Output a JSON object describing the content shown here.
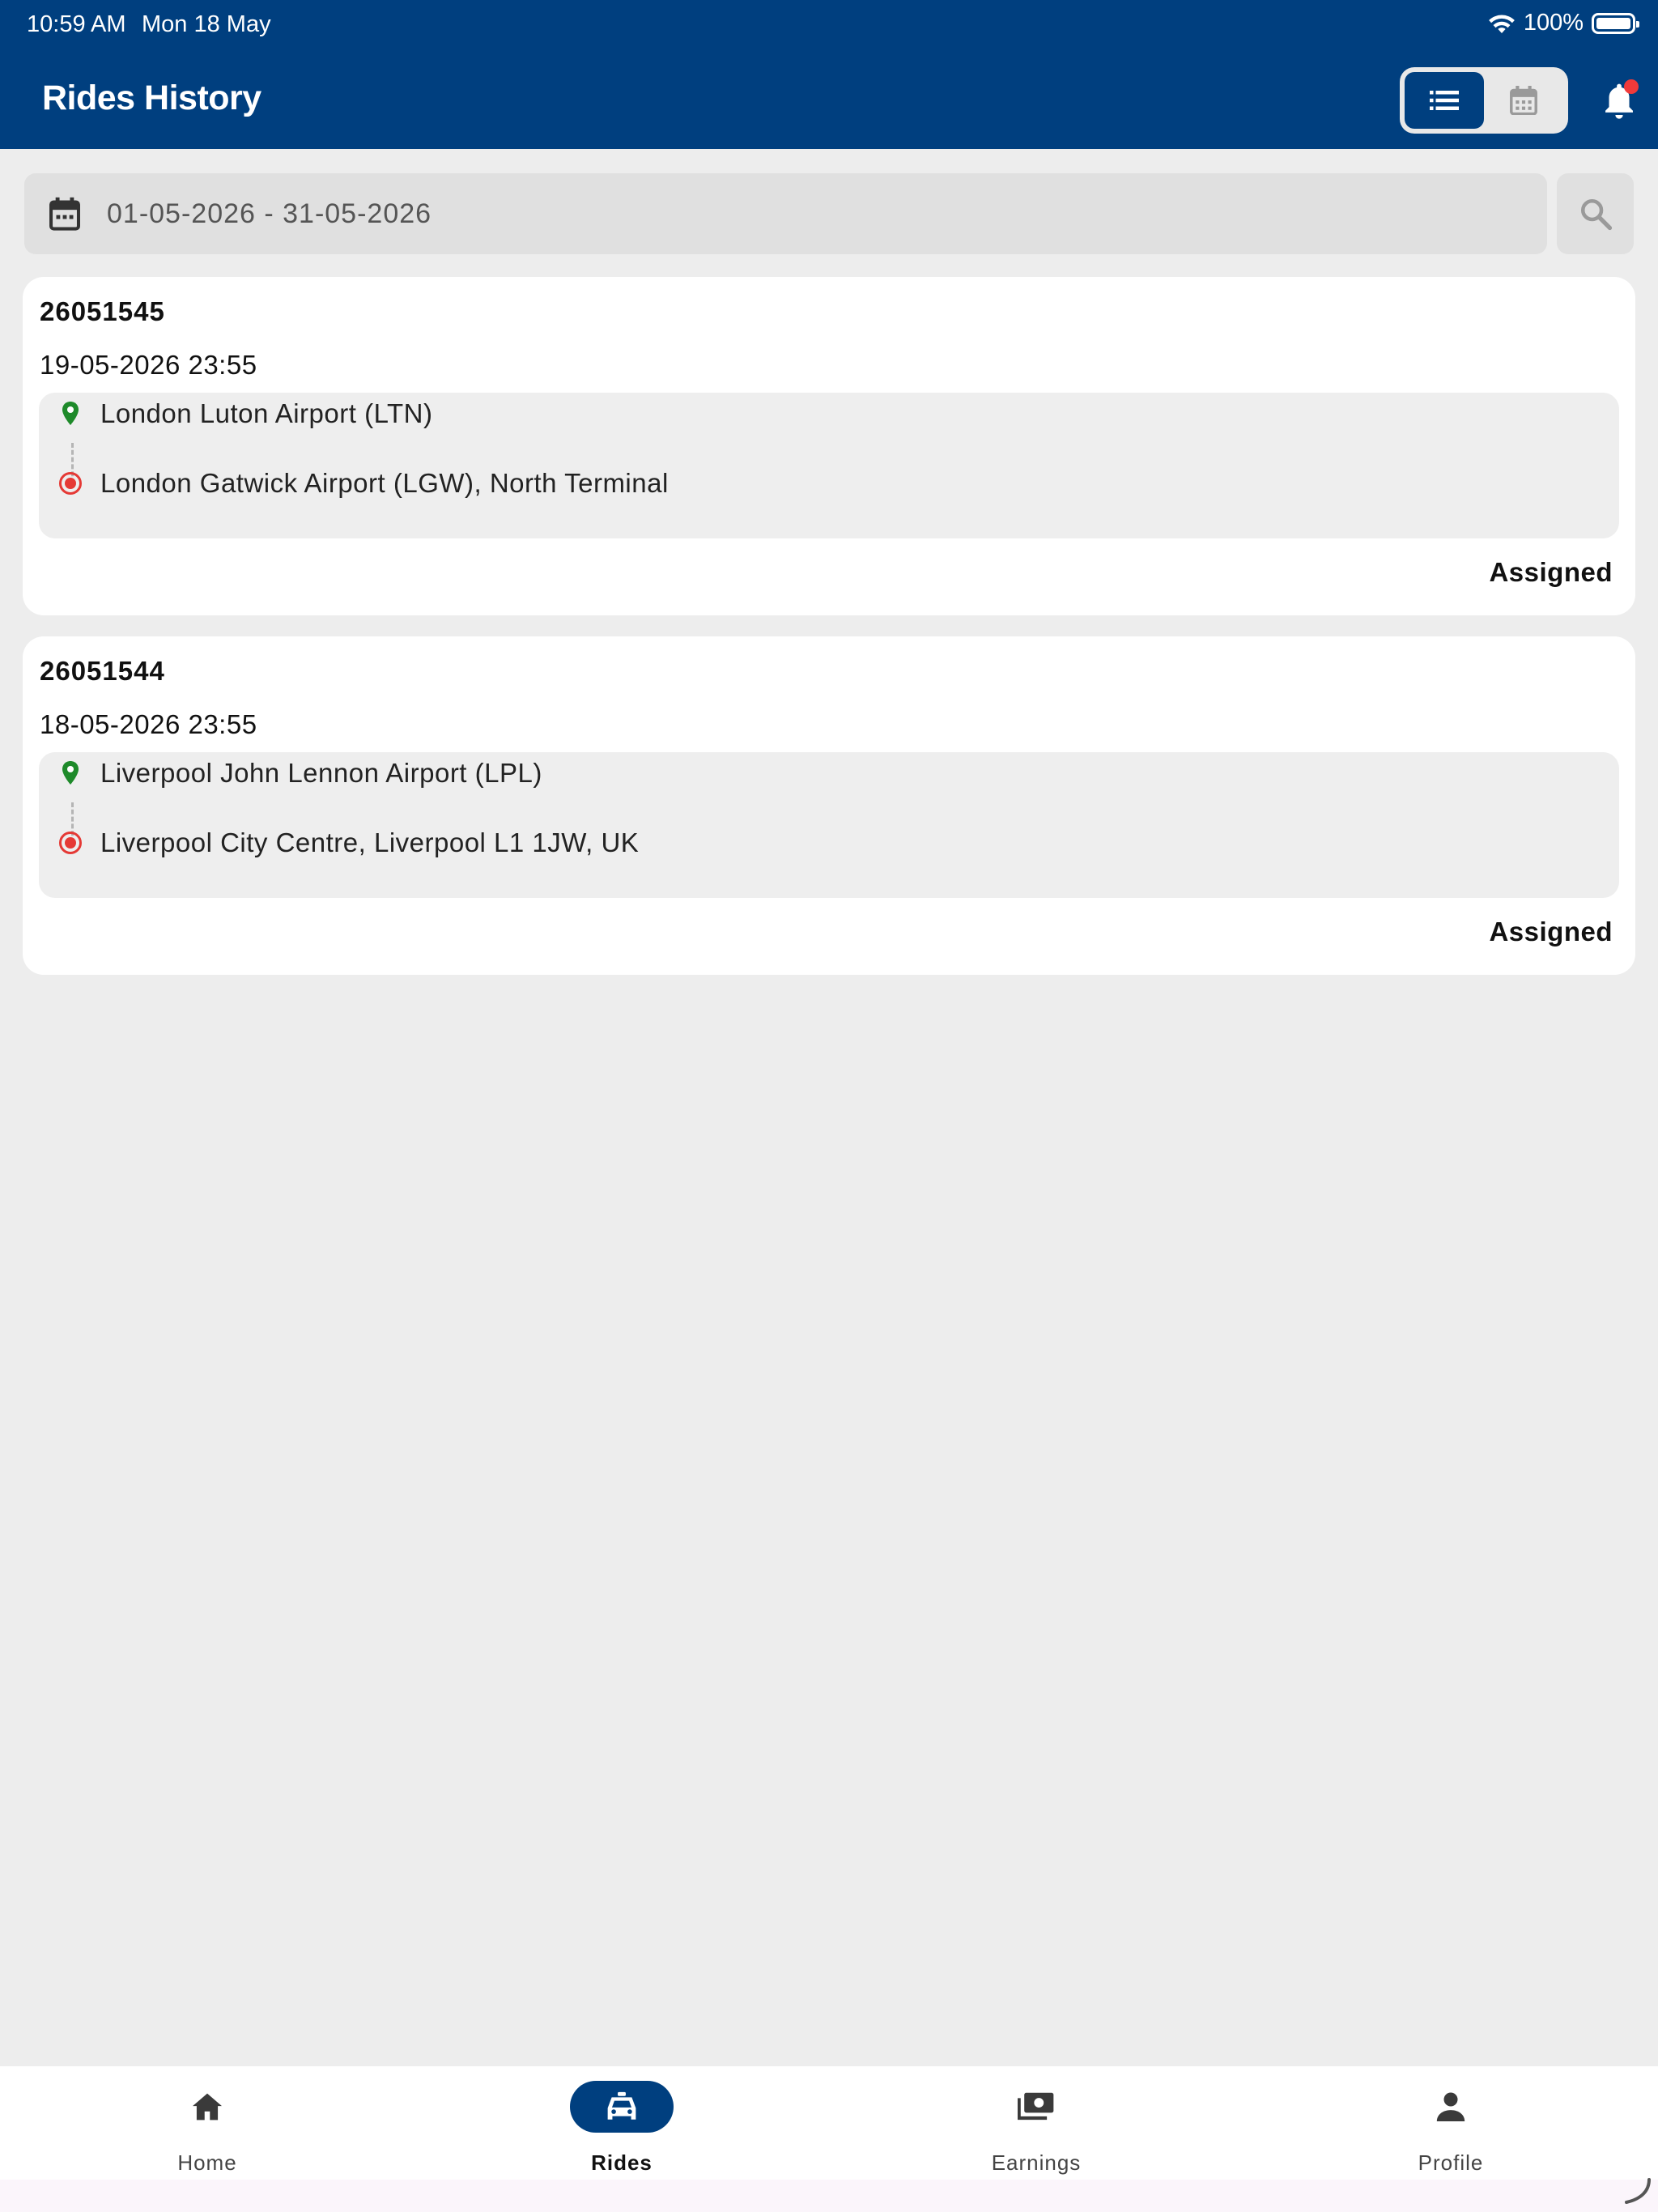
{
  "status_bar": {
    "time": "10:59 AM",
    "date": "Mon 18 May",
    "battery": "100%"
  },
  "header": {
    "title": "Rides History",
    "view_toggle": [
      "list-icon",
      "calendar-icon"
    ],
    "active_view": "list"
  },
  "filter": {
    "date_range": "01-05-2026 - 31-05-2026"
  },
  "rides": [
    {
      "id": "26051545",
      "datetime": "19-05-2026 23:55",
      "pickup": "London Luton Airport (LTN)",
      "dropoff": "London Gatwick Airport (LGW), North Terminal",
      "status": "Assigned"
    },
    {
      "id": "26051544",
      "datetime": "18-05-2026 23:55",
      "pickup": "Liverpool John Lennon Airport (LPL)",
      "dropoff": "Liverpool City Centre, Liverpool L1 1JW, UK",
      "status": "Assigned"
    }
  ],
  "nav": {
    "items": [
      {
        "label": "Home",
        "icon": "home-icon"
      },
      {
        "label": "Rides",
        "icon": "car-icon"
      },
      {
        "label": "Earnings",
        "icon": "money-icon"
      },
      {
        "label": "Profile",
        "icon": "person-icon"
      }
    ],
    "active": "Rides"
  },
  "colors": {
    "primary": "#003f7f",
    "pickup_pin": "#1e8a2a",
    "dropoff_pin": "#e53935",
    "notification_dot": "#f03a3a",
    "background": "#ededed"
  }
}
